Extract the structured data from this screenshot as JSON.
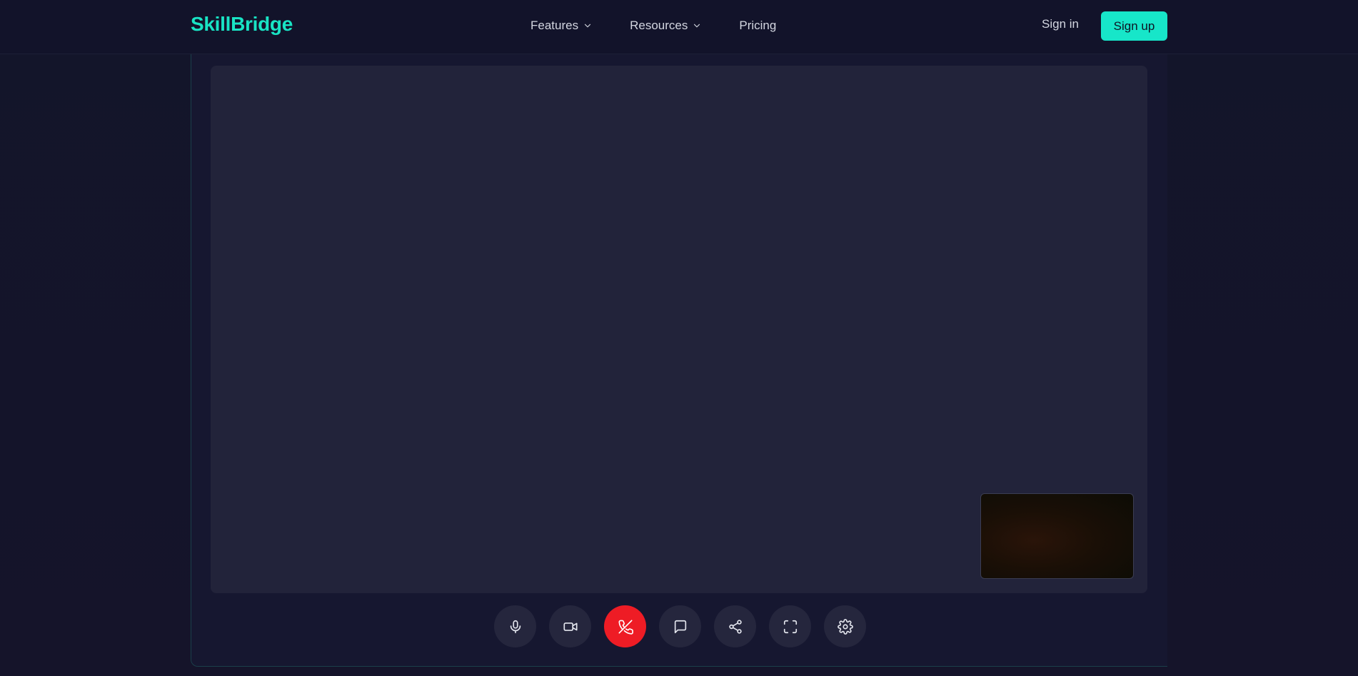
{
  "brand": {
    "name": "SkillBridge",
    "color": "#19e3c4"
  },
  "nav": {
    "items": [
      {
        "label": "Features",
        "has_dropdown": true
      },
      {
        "label": "Resources",
        "has_dropdown": true
      },
      {
        "label": "Pricing",
        "has_dropdown": false
      }
    ],
    "sign_in": "Sign in",
    "sign_up": "Sign up",
    "sign_up_color": "#17e6c9"
  },
  "call": {
    "controls": [
      {
        "name": "microphone",
        "icon": "mic-icon"
      },
      {
        "name": "camera",
        "icon": "video-icon"
      },
      {
        "name": "end-call",
        "icon": "phone-off-icon",
        "color": "#ee1c25"
      },
      {
        "name": "chat",
        "icon": "chat-icon"
      },
      {
        "name": "share",
        "icon": "share-icon"
      },
      {
        "name": "fullscreen",
        "icon": "fullscreen-icon"
      },
      {
        "name": "settings",
        "icon": "gear-icon"
      }
    ]
  }
}
